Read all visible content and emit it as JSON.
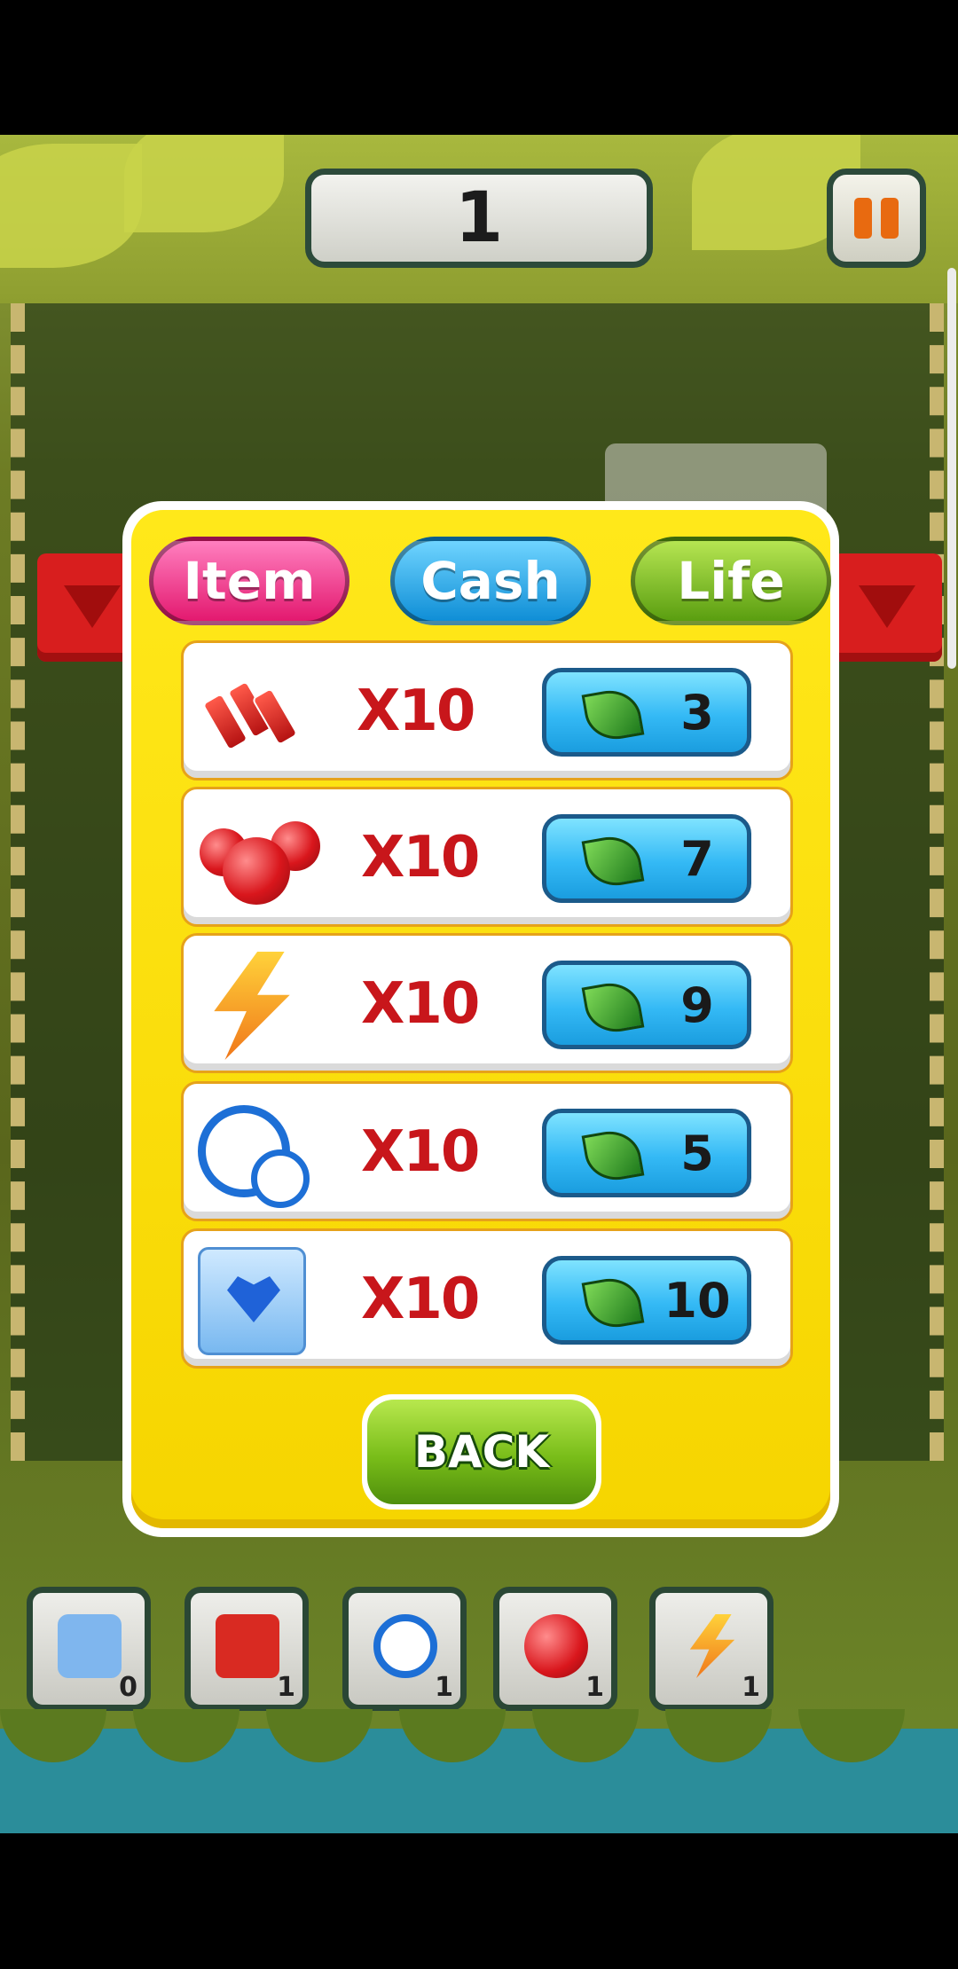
{
  "hud": {
    "level_number": "1",
    "pause_icon": "pause-icon"
  },
  "dialog": {
    "tabs": [
      {
        "label": "Item",
        "color": "#e3196f"
      },
      {
        "label": "Cash",
        "color": "#0f8ed6"
      },
      {
        "label": "Life",
        "color": "#5a9e10"
      }
    ],
    "currency_icon": "leaf-icon",
    "rows": [
      {
        "icon": "dynamite-icon",
        "quantity": "X10",
        "price": "3"
      },
      {
        "icon": "cherry-bomb-icon",
        "quantity": "X10",
        "price": "7"
      },
      {
        "icon": "lightning-icon",
        "quantity": "X10",
        "price": "9"
      },
      {
        "icon": "clock-icon",
        "quantity": "X10",
        "price": "5"
      },
      {
        "icon": "ice-block-icon",
        "quantity": "X10",
        "price": "10"
      }
    ],
    "back_label": "BACK"
  },
  "inventory": [
    {
      "icon": "ice-block-icon",
      "count": "0"
    },
    {
      "icon": "dynamite-icon",
      "count": "1"
    },
    {
      "icon": "clock-icon",
      "count": "1"
    },
    {
      "icon": "cherry-bomb-icon",
      "count": "1"
    },
    {
      "icon": "lightning-icon",
      "count": "1"
    }
  ]
}
